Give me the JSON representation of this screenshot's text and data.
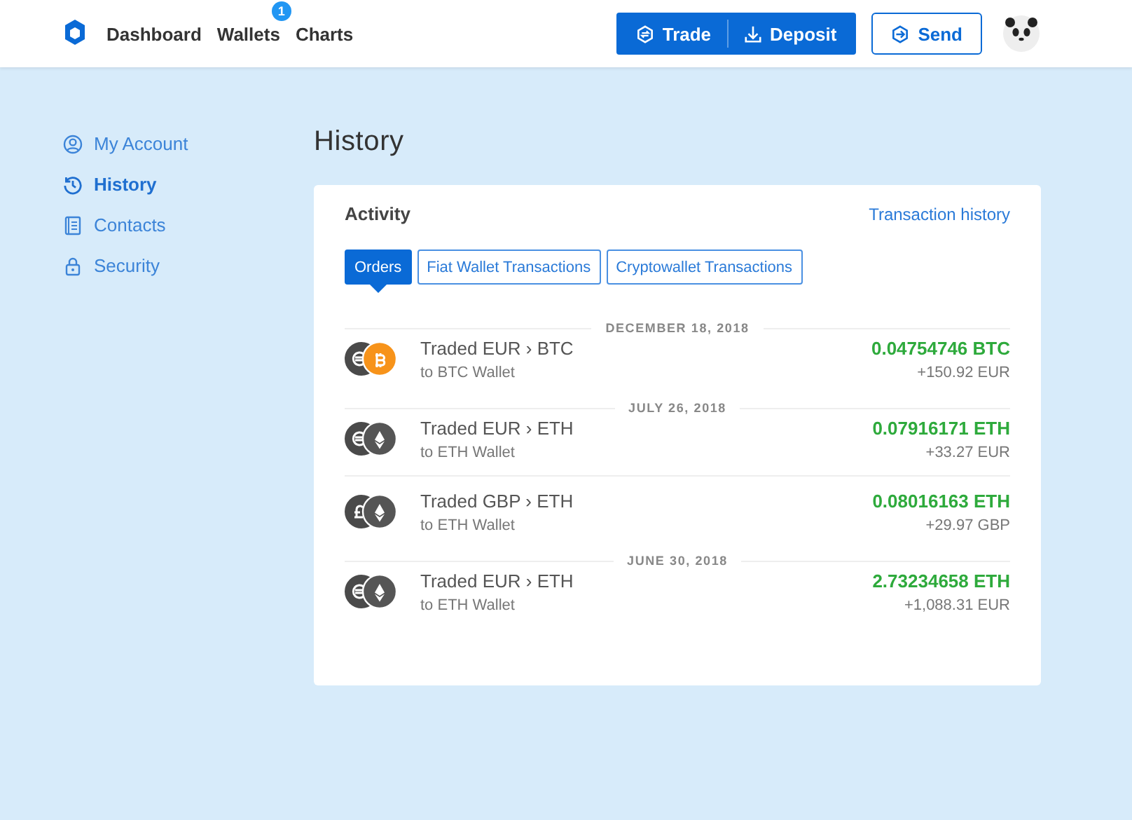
{
  "header": {
    "nav": [
      {
        "label": "Dashboard"
      },
      {
        "label": "Wallets",
        "badge": "1"
      },
      {
        "label": "Charts"
      }
    ],
    "actions": [
      {
        "label": "Trade",
        "kind": "trade"
      },
      {
        "label": "Deposit",
        "kind": "deposit"
      }
    ],
    "send": {
      "label": "Send"
    }
  },
  "sidebar": {
    "items": [
      {
        "label": "My Account",
        "kind": "account",
        "selected": false
      },
      {
        "label": "History",
        "kind": "history",
        "selected": true
      },
      {
        "label": "Contacts",
        "kind": "contacts",
        "selected": false
      },
      {
        "label": "Security",
        "kind": "security",
        "selected": false
      }
    ]
  },
  "page_title": "History",
  "activity": {
    "title": "Activity",
    "link": "Transaction history",
    "tabs": [
      {
        "label": "Orders",
        "selected": true
      },
      {
        "label": "Fiat Wallet Transactions",
        "selected": false
      },
      {
        "label": "Cryptowallet Transactions",
        "selected": false
      }
    ],
    "groups": [
      {
        "date": "DECEMBER 18, 2018",
        "transactions": [
          {
            "kind": "eur-btc",
            "title": "Traded EUR › BTC",
            "subtitle": "to BTC Wallet",
            "amount": "0.04754746 BTC",
            "value": "+150.92 EUR"
          }
        ]
      },
      {
        "date": "JULY 26, 2018",
        "transactions": [
          {
            "kind": "eur-eth",
            "title": "Traded EUR › ETH",
            "subtitle": "to ETH Wallet",
            "amount": "0.07916171 ETH",
            "value": "+33.27 EUR"
          },
          {
            "kind": "gbp-eth",
            "title": "Traded GBP › ETH",
            "subtitle": "to ETH Wallet",
            "amount": "0.08016163 ETH",
            "value": "+29.97 GBP"
          }
        ]
      },
      {
        "date": "JUNE 30, 2018",
        "transactions": [
          {
            "kind": "eur-eth",
            "title": "Traded EUR › ETH",
            "subtitle": "to ETH Wallet",
            "amount": "2.73234658 ETH",
            "value": "+1,088.31 EUR"
          }
        ]
      }
    ]
  }
}
